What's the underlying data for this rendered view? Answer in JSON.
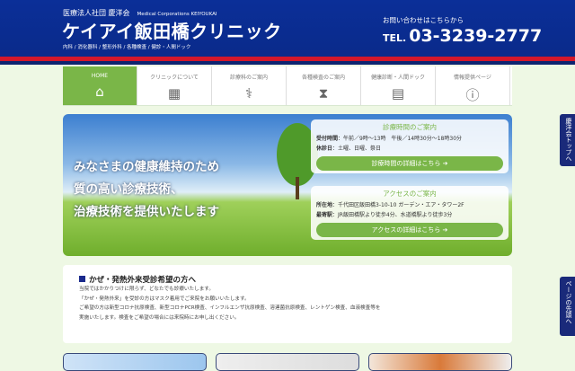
{
  "header": {
    "org": "医療法人社団 慶洋会",
    "org_en": "Medical Corporations KEIYOUKAI",
    "title": "ケイアイ飯田橋クリニック",
    "departments": "内科 / 消化器科 / 整形外科 / 各種検査 / 健診・人間ドック",
    "contact_label": "お問い合わせはこちらから",
    "tel_prefix": "TEL.",
    "tel": "03-3239-2777"
  },
  "nav": [
    {
      "label": "HOME",
      "icon": "home-icon",
      "glyph": "⌂"
    },
    {
      "label": "クリニックについて",
      "icon": "hospital-icon",
      "glyph": "▦"
    },
    {
      "label": "診療科のご案内",
      "icon": "stethoscope-icon",
      "glyph": "⚕"
    },
    {
      "label": "各種検査のご案内",
      "icon": "hourglass-icon",
      "glyph": "⧗"
    },
    {
      "label": "健康診断・人間ドック",
      "icon": "clipboard-icon",
      "glyph": "▤"
    },
    {
      "label": "情報提供ページ",
      "icon": "info-icon",
      "glyph": "ⓘ"
    }
  ],
  "hero": {
    "lines": [
      "みなさまの健康維持のため",
      "質の高い診療技術、",
      "治療技術を提供いたします"
    ]
  },
  "hours": {
    "heading": "診療時間のご案内",
    "reception_label": "受付時間",
    "reception": "：午前／9時～13時　午後／14時30分～18時30分",
    "closed_label": "休診日",
    "closed": "：土曜、日曜、祭日",
    "button": "診療時間の詳細はこちら"
  },
  "access": {
    "heading": "アクセスのご案内",
    "address_label": "所在地",
    "address": "：千代田区飯田橋3-10-10 ガーデン・エア・タワー2F",
    "station_label": "最寄駅",
    "station": "：JR飯田橋駅より徒歩4分、水道橋駅より徒歩3分",
    "button": "アクセスの詳細はこちら"
  },
  "notice": {
    "heading": "かぜ・発熱外来受診希望の方へ",
    "lines": [
      "当院ではかかりつけに限らず、どなたでも診療いたします。",
      "「かぜ・発熱外来」を受診の方はマスク着用でご来院をお願いいたします。",
      "ご希望の方は新型コロナ抗原検査、新型コロナPCR検査、インフルエンザ抗原検査、溶連菌抗原検査、レントゲン検査、血液検査等を",
      "実施いたします。検査をご希望の場合には来院時にお申し出ください。"
    ]
  },
  "side": {
    "top_link": "慶洋会トップへ",
    "page_top": "ページの先頭へ"
  },
  "colors": {
    "brand_blue": "#0b2f98",
    "accent_green": "#7ab648",
    "stripe_red": "#d3172a"
  }
}
